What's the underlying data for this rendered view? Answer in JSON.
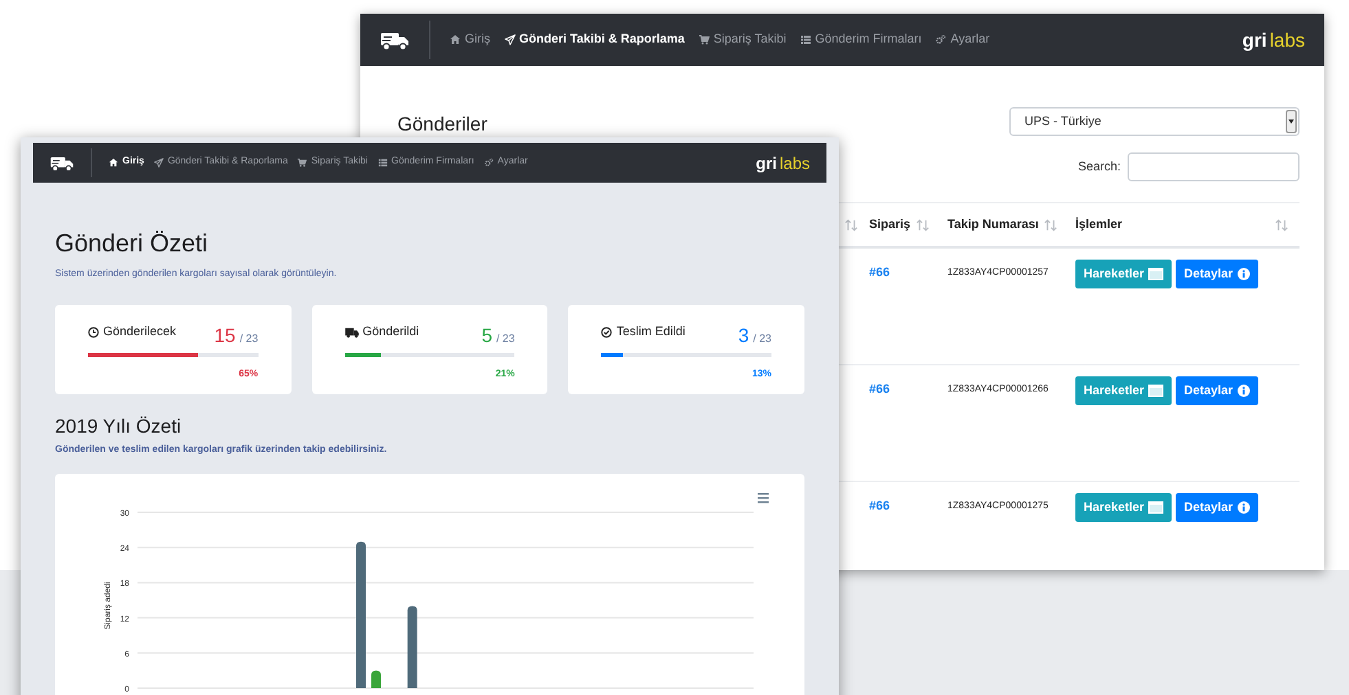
{
  "back_window": {
    "navbar": {
      "items": [
        {
          "label": "Giriş",
          "selected": false
        },
        {
          "label": "Gönderi Takibi & Raporlama",
          "selected": true
        },
        {
          "label": "Sipariş Takibi",
          "selected": false
        },
        {
          "label": "Gönderim Firmaları",
          "selected": false
        },
        {
          "label": "Ayarlar",
          "selected": false
        }
      ],
      "logo": {
        "part_1": "gri",
        "part_2": "labs"
      }
    },
    "title": "Gönderiler",
    "carrier_select": {
      "value": "UPS - Türkiye"
    },
    "search": {
      "label": "Search:"
    },
    "table": {
      "columns": [
        {
          "kind": "sort-only"
        },
        {
          "kind": "sortable",
          "label": "Sipariş"
        },
        {
          "kind": "sortable",
          "label": "Takip Numarası"
        },
        {
          "kind": "sortable",
          "label": "İşlemler"
        }
      ],
      "rows": [
        {
          "order": "#66",
          "tracking": "1Z833AY4CP00001257",
          "actions": [
            "Hareketler",
            "Detaylar"
          ]
        },
        {
          "order": "#66",
          "tracking": "1Z833AY4CP00001266",
          "actions": [
            "Hareketler",
            "Detaylar"
          ]
        },
        {
          "order": "#66",
          "tracking": "1Z833AY4CP00001275",
          "actions": [
            "Hareketler",
            "Detaylar"
          ]
        }
      ]
    }
  },
  "front_window": {
    "navbar": {
      "items": [
        {
          "label": "Giriş",
          "selected": true
        },
        {
          "label": "Gönderi Takibi & Raporlama",
          "selected": false
        },
        {
          "label": "Sipariş Takibi",
          "selected": false
        },
        {
          "label": "Gönderim Firmaları",
          "selected": false
        },
        {
          "label": "Ayarlar",
          "selected": false
        }
      ],
      "logo": {
        "part_1": "gri",
        "part_2": "labs"
      }
    },
    "title": "Gönderi Özeti",
    "subtitle": "Sistem üzerinden gönderilen kargoları sayısal olarak görüntüleyin.",
    "stat_cards": [
      {
        "label": "Gönderilecek",
        "value": "15",
        "total": "/ 23",
        "percent": "65%",
        "level": 0.65,
        "color": "#dc3545"
      },
      {
        "label": "Gönderildi",
        "value": "5",
        "total": "/ 23",
        "percent": "21%",
        "level": 0.21,
        "color": "#28a745"
      },
      {
        "label": "Teslim Edildi",
        "value": "3",
        "total": "/ 23",
        "percent": "13%",
        "level": 0.13,
        "color": "#007bff"
      }
    ],
    "chart_title": "2019 Yılı Özeti",
    "chart_subtitle": "Gönderilen ve teslim edilen kargoları grafik üzerinden takip edebilirsiniz.",
    "chart": {
      "chart_data": {
        "type": "bar",
        "ylabel": "Sipariş adedi",
        "ylim": [
          0,
          30
        ],
        "grid": true,
        "yticks": [
          0,
          6,
          12,
          18,
          24,
          30
        ],
        "series": [
          {
            "color": "#4f6a7a",
            "values": [
              0,
              0,
              0,
              0,
              25,
              14,
              0,
              0,
              0,
              0,
              0,
              0
            ]
          },
          {
            "color": "#3aa53a",
            "values": [
              0,
              0,
              0,
              0,
              3,
              0,
              0,
              0,
              0,
              0,
              0,
              0
            ]
          }
        ]
      }
    }
  }
}
